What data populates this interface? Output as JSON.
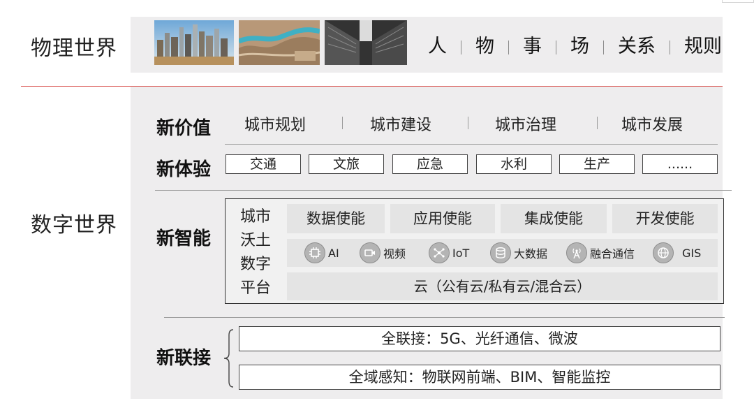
{
  "physical_world": {
    "label": "物理世界",
    "photos": [
      "city-skyline-photo",
      "river-landscape-photo",
      "building-street-photo"
    ],
    "elements": [
      "人",
      "物",
      "事",
      "场",
      "关系",
      "规则"
    ]
  },
  "digital_world": {
    "label": "数字世界",
    "new_value": {
      "label": "新价值",
      "items": [
        "城市规划",
        "城市建设",
        "城市治理",
        "城市发展"
      ]
    },
    "new_experience": {
      "label": "新体验",
      "items": [
        "交通",
        "文旅",
        "应急",
        "水利",
        "生产",
        "......"
      ]
    },
    "new_intelligence": {
      "label": "新智能",
      "platform_name": [
        "城市",
        "沃土",
        "数字",
        "平台"
      ],
      "enablements": [
        "数据使能",
        "应用使能",
        "集成使能",
        "开发使能"
      ],
      "technologies": [
        {
          "label": "AI",
          "icon": "ai-chip-icon"
        },
        {
          "label": "视频",
          "icon": "video-camera-icon"
        },
        {
          "label": "IoT",
          "icon": "iot-network-icon"
        },
        {
          "label": "大数据",
          "icon": "big-data-icon"
        },
        {
          "label": "融合通信",
          "icon": "signal-tower-icon"
        },
        {
          "label": "GIS",
          "icon": "gis-globe-icon"
        }
      ],
      "cloud": "云（公有云/私有云/混合云）"
    },
    "new_connection": {
      "label": "新联接",
      "items": [
        "全联接：5G、光纤通信、微波",
        "全域感知：物联网前端、BIM、智能监控"
      ]
    }
  },
  "colors": {
    "divider_red": "#d9534f",
    "panel_gray": "#eeedee",
    "box_gray": "#e4e4e4"
  }
}
